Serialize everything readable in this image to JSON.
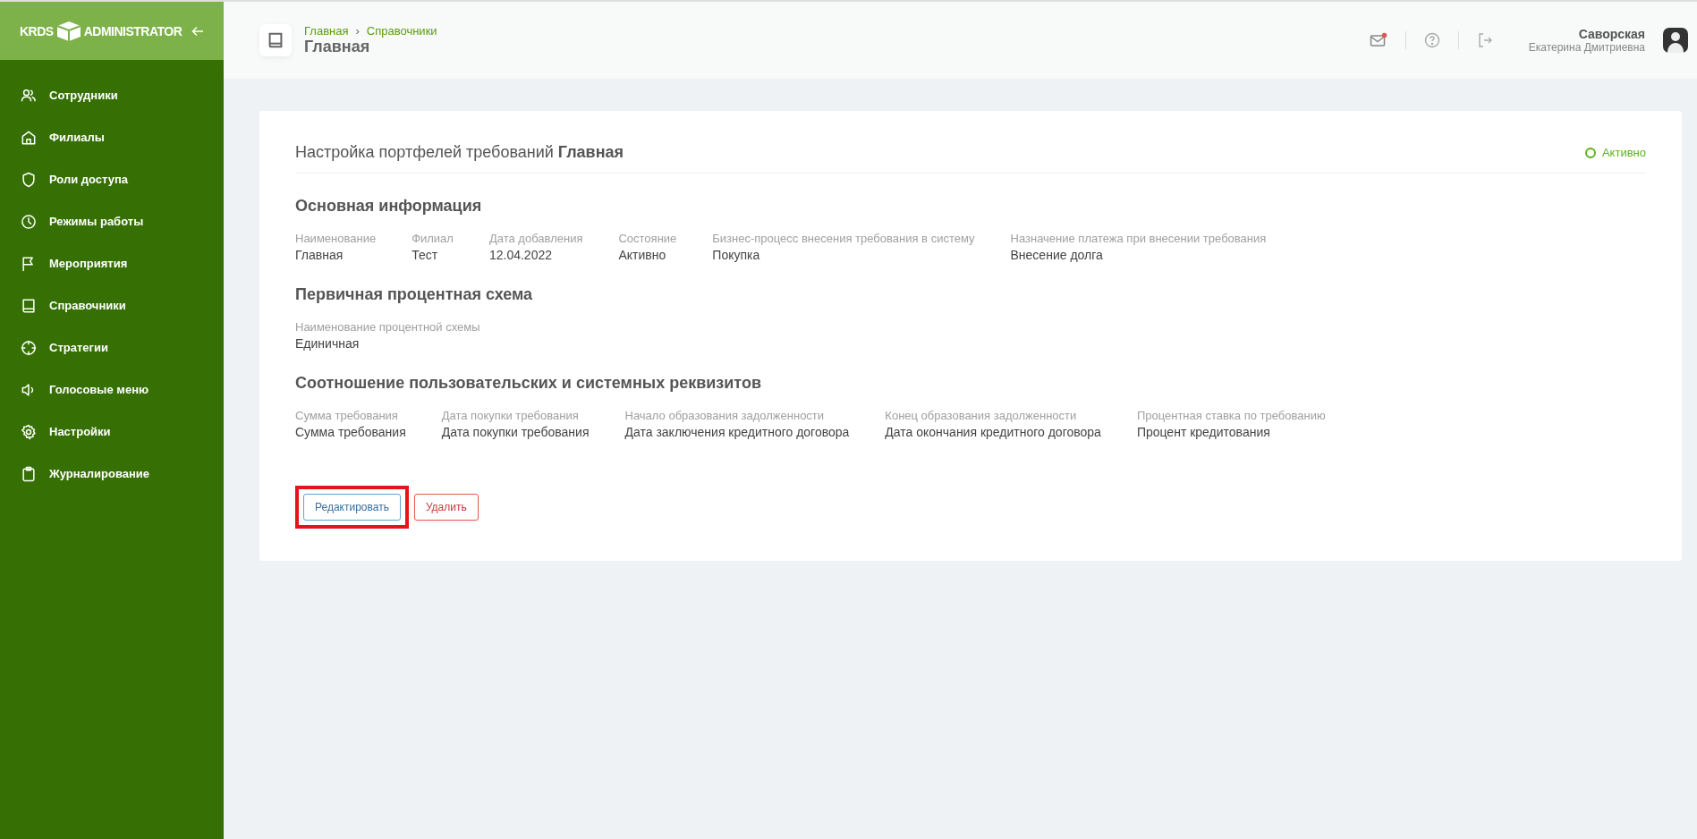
{
  "logo": {
    "left": "KRDS",
    "right": "ADMINISTRATOR"
  },
  "sidebar": {
    "items": [
      {
        "label": "Сотрудники",
        "kind": "users",
        "selected": false
      },
      {
        "label": "Филиалы",
        "kind": "home",
        "selected": false
      },
      {
        "label": "Роли доступа",
        "kind": "shield",
        "selected": false
      },
      {
        "label": "Режимы работы",
        "kind": "clock",
        "selected": false
      },
      {
        "label": "Мероприятия",
        "kind": "flag",
        "selected": false
      },
      {
        "label": "Справочники",
        "kind": "book",
        "selected": false
      },
      {
        "label": "Стратегии",
        "kind": "target",
        "selected": false
      },
      {
        "label": "Голосовые меню",
        "kind": "speaker",
        "selected": false
      },
      {
        "label": "Настройки",
        "kind": "gear",
        "selected": false
      },
      {
        "label": "Журналирование",
        "kind": "clipboard",
        "selected": false
      }
    ]
  },
  "header": {
    "breadcrumbs": [
      "Главная",
      "Справочники"
    ],
    "separator": "›",
    "title": "Главная",
    "mail_unread": true,
    "user": {
      "last_name": "Саворская",
      "first_names": "Екатерина Дмитриевна"
    }
  },
  "card": {
    "title": "Настройка портфелей требований **Главная**",
    "status": "Активно",
    "status_active": true,
    "sections": [
      {
        "heading": "Основная информация",
        "fields": [
          {
            "label": "Наименование",
            "value": "Главная"
          },
          {
            "label": "Филиал",
            "value": "Тест"
          },
          {
            "label": "Дата добавления",
            "value": "12.04.2022"
          },
          {
            "label": "Состояние",
            "value": "Активно"
          },
          {
            "label": "Бизнес-процесс внесения требования в систему",
            "value": "Покупка"
          },
          {
            "label": "Назначение платежа при внесении требования",
            "value": "Внесение долга"
          }
        ]
      },
      {
        "heading": "Первичная процентная схема",
        "fields": [
          {
            "label": "Наименование процентной схемы",
            "value": "Единичная"
          }
        ]
      },
      {
        "heading": "Соотношение пользовательских и системных реквизитов",
        "fields": [
          {
            "label": "Сумма требования",
            "value": "Сумма требования"
          },
          {
            "label": "Дата покупки требования",
            "value": "Дата покупки требования"
          },
          {
            "label": "Начало образования задолженности",
            "value": "Дата заключения кредитного договора"
          },
          {
            "label": "Конец образования задолженности",
            "value": "Дата окончания кредитного договора"
          },
          {
            "label": "Процентная ставка по требованию",
            "value": "Процент кредитования"
          }
        ]
      }
    ],
    "buttons": [
      {
        "label": "Редактировать",
        "kind": "edit",
        "highlighted": true
      },
      {
        "label": "Удалить",
        "kind": "delete",
        "highlighted": false
      }
    ]
  }
}
